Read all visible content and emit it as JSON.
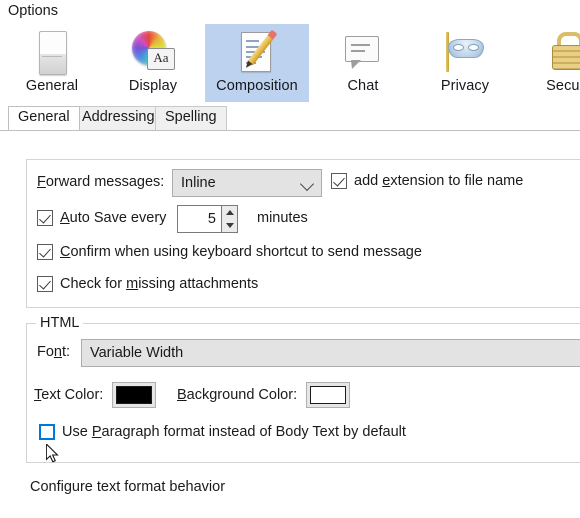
{
  "window": {
    "title": "Options"
  },
  "toolbar": {
    "items": [
      {
        "label": "General",
        "icon": "general-icon",
        "selected": false
      },
      {
        "label": "Display",
        "icon": "display-icon",
        "selected": false
      },
      {
        "label": "Composition",
        "icon": "composition-icon",
        "selected": true
      },
      {
        "label": "Chat",
        "icon": "chat-icon",
        "selected": false
      },
      {
        "label": "Privacy",
        "icon": "privacy-icon",
        "selected": false
      },
      {
        "label": "Securi",
        "icon": "security-icon",
        "selected": false
      }
    ],
    "selected_color": "#bcd2ee"
  },
  "tabs": {
    "items": [
      {
        "label": "General",
        "active": true
      },
      {
        "label": "Addressing",
        "active": false
      },
      {
        "label": "Spelling",
        "active": false
      }
    ]
  },
  "general_group": {
    "forward_label_pre": "F",
    "forward_label_post": "orward messages:",
    "forward_value": "Inline",
    "add_extension": {
      "pre": "add ",
      "key": "e",
      "post": "xtension to file name",
      "checked": true
    },
    "auto_save": {
      "pre": "",
      "key": "A",
      "post": "uto Save every",
      "checked": true,
      "value": "5",
      "unit": "minutes"
    },
    "confirm_shortcut": {
      "pre": "",
      "key": "C",
      "post": "onfirm when using keyboard shortcut to send message",
      "checked": true
    },
    "check_attachments": {
      "pre": "Check for ",
      "key": "m",
      "post": "issing attachments",
      "checked": true
    }
  },
  "html_group": {
    "legend": "HTML",
    "font_label_pre": "Fo",
    "font_label_key": "n",
    "font_label_post": "t:",
    "font_value": "Variable Width",
    "text_color": {
      "pre": "",
      "key": "T",
      "post": "ext Color:",
      "value": "#000000"
    },
    "background_color": {
      "pre": "",
      "key": "B",
      "post": "ackground Color:",
      "value": "#ffffff"
    },
    "paragraph_format": {
      "pre": "Use ",
      "key": "P",
      "post": "aragraph format instead of Body Text by default",
      "checked": false,
      "hover": true
    }
  },
  "status": {
    "text": "Configure text format behavior"
  }
}
